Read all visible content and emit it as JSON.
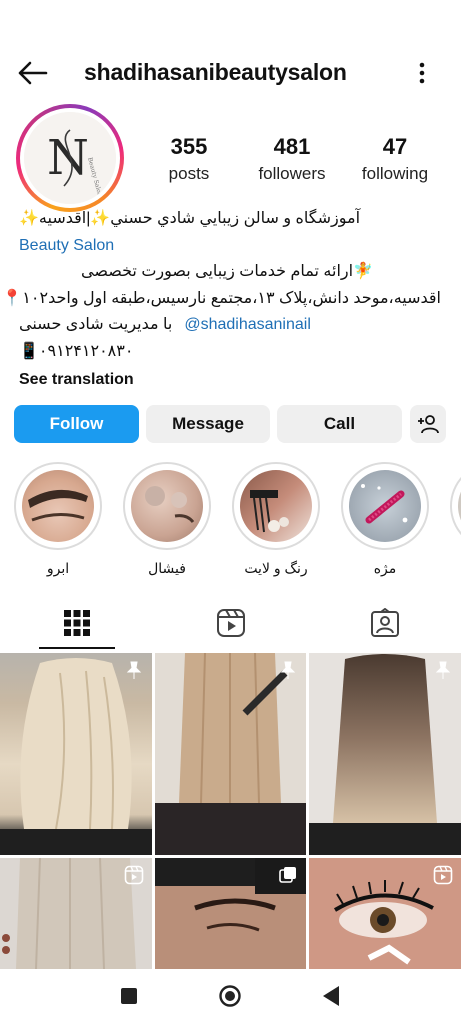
{
  "header": {
    "username": "shadihasanibeautysalon",
    "back_icon": "arrow-left-icon",
    "more_icon": "more-vertical-icon"
  },
  "profile": {
    "avatar_text": "N",
    "avatar_script": "Beauty Salon"
  },
  "stats": [
    {
      "value": "355",
      "label": "posts"
    },
    {
      "value": "481",
      "label": "followers"
    },
    {
      "value": "47",
      "label": "following"
    }
  ],
  "bio": {
    "line1": "آموزشگاه و سالن زيبايي شادي حسني✨|اقدسیه✨",
    "category": "Beauty Salon",
    "line3": "🧚ارائه تمام خدمات زیبایی بصورت تخصصی",
    "line4": "اقدسیه،موحد دانش،پلاک ۱۳،مجتمع نارسیس،طبقه اول واحد۱۰۲📍",
    "line5_handle": "@shadihasaninail",
    "line5_text": "با مدیریت شادی حسنی",
    "phone": "۰۹۱۲۴۱۲۰۸۳۰",
    "see_translation": "See translation"
  },
  "buttons": {
    "follow": "Follow",
    "message": "Message",
    "call": "Call"
  },
  "highlights": [
    {
      "label": "ابرو"
    },
    {
      "label": "فیشال"
    },
    {
      "label": "رنگ و لایت"
    },
    {
      "label": "مژه"
    }
  ],
  "tabs": [
    "grid-icon",
    "reels-icon",
    "tagged-icon"
  ],
  "colors": {
    "follow_button": "#1b9bf0",
    "link": "#1f6fb5",
    "secondary_button": "#efefef"
  }
}
